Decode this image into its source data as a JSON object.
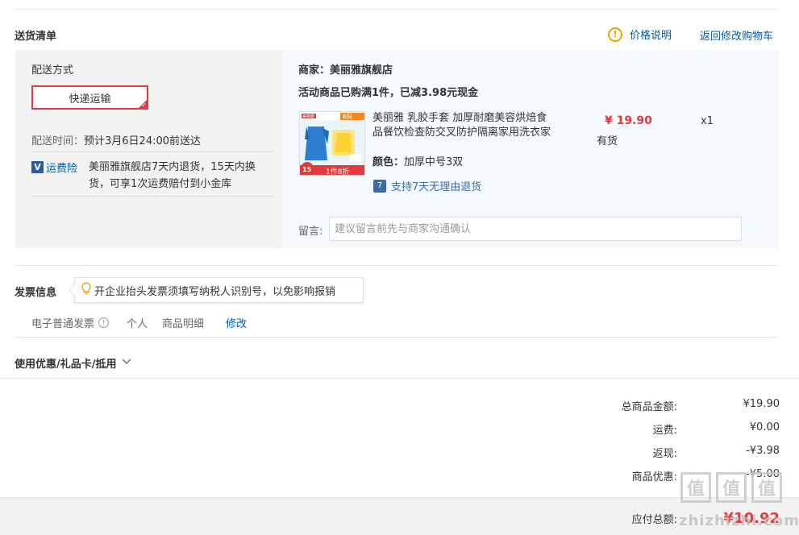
{
  "delivery": {
    "title": "送货清单",
    "price_note_label": "价格说明",
    "back_to_cart_label": "返回修改购物车",
    "shipping_method_title": "配送方式",
    "shipping_option": "快递运输",
    "delivery_time_label": "配送时间：",
    "delivery_time_value": "预计3月6日24:00前送达",
    "insurance_label": "运费险",
    "insurance_text_line1": "美丽雅旗舰店7天内退货，15天内换",
    "insurance_text_line2": "货，可享1次运费赔付到小金库",
    "merchant_label": "商家：",
    "merchant_name": "美丽雅旗舰店",
    "promo_text": "活动商品已购满1件，已减3.98元现金",
    "product": {
      "title_line1": "美丽雅 乳胶手套 加厚耐磨美容烘焙食",
      "title_line2": "品餐饮检查防交叉防护隔离家用洗衣家",
      "price": "¥ 19.90",
      "stock": "有货",
      "quantity": "x1",
      "color_label": "颜色：",
      "color_value": "加厚中号3双",
      "return_policy": "支持7天无理由退货",
      "thumb_tag": "6只",
      "thumb_badge": "1件8折",
      "thumb_count": "15",
      "thumb_brand": "美丽雅"
    },
    "note_label": "留言:",
    "note_placeholder": "建议留言前先与商家沟通确认"
  },
  "invoice": {
    "title": "发票信息",
    "tip": "开企业抬头发票须填写纳税人识别号，以免影响报销",
    "type": "电子普通发票",
    "header": "个人",
    "content": "商品明细",
    "edit_label": "修改"
  },
  "coupon": {
    "title": "使用优惠/礼品卡/抵用"
  },
  "summary": {
    "rows": [
      {
        "label": "总商品金额:",
        "value": "¥19.90"
      },
      {
        "label": "运费:",
        "value": "¥0.00"
      },
      {
        "label": "返现:",
        "value": "-¥3.98"
      },
      {
        "label": "商品优惠:",
        "value": "-¥5.00"
      }
    ],
    "total_label": "应付总额:",
    "total_value": "¥10.92"
  },
  "watermark": {
    "glyph": "值",
    "site": "zhizhizhi.com"
  },
  "colors": {
    "accent_red": "#e4393c",
    "link_blue": "#005aa0",
    "tip_yellow": "#f0a100"
  }
}
